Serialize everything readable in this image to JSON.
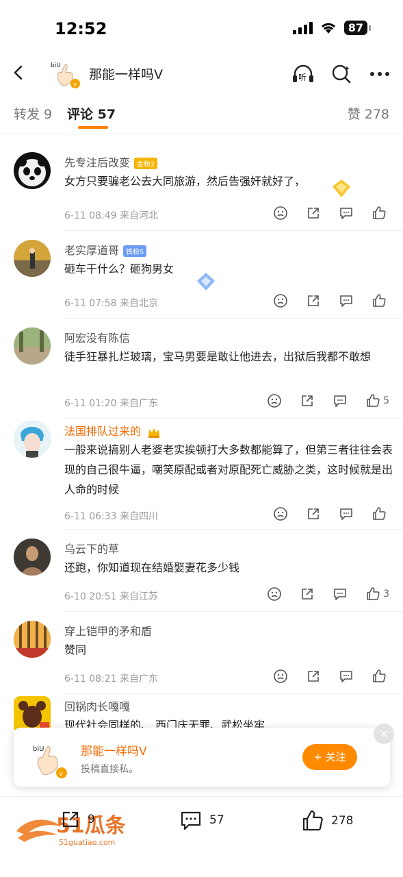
{
  "status": {
    "time": "12:52",
    "battery": "87"
  },
  "nav": {
    "title": "那能一样吗V",
    "listen_label": "听"
  },
  "tabs": {
    "repost": "转发 9",
    "comments": "评论 57",
    "likes": "赞 278"
  },
  "comments": [
    {
      "name": "先专注后改变",
      "badge": "金粉2",
      "badge_type": "gold",
      "text": "女方只要骗老公去大同旅游，然后告强奸就好了，",
      "meta": "6-11 08:49 来自河北",
      "likes": ""
    },
    {
      "name": "老实厚道哥",
      "badge": "铁粉5",
      "badge_type": "iron",
      "text": "砸车干什么？砸狗男女",
      "meta": "6-11 07:58 来自北京",
      "likes": ""
    },
    {
      "name": "阿宏没有陈信",
      "badge": "",
      "text": "徒手狂暴扎烂玻璃，宝马男要是敢让他进去，出狱后我都不敢想",
      "meta": "6-11 01:20 来自广东",
      "likes": "5"
    },
    {
      "name": "法国排队过来的",
      "badge": "",
      "vip": true,
      "text": "一般来说搞别人老婆老实挨顿打大多数都能算了，但第三者往往会表现的自己很牛逼，嘲笑原配或者对原配死亡威胁之类，这时候就是出人命的时候",
      "meta": "6-11 06:33 来自四川",
      "likes": ""
    },
    {
      "name": "乌云下的草",
      "badge": "",
      "text": "还跑，你知道现在结婚娶妻花多少钱",
      "meta": "6-10 20:51 来自江苏",
      "likes": "3"
    },
    {
      "name": "穿上铠甲的矛和盾",
      "badge": "",
      "text": "赞同",
      "meta": "6-11 08:21 来自广东",
      "likes": ""
    },
    {
      "name": "回锅肉长嘎嘎",
      "badge": "",
      "text": "现代社会同样的、 西门庆无罪、武松坐牢",
      "meta": "",
      "likes": ""
    }
  ],
  "popup": {
    "name": "那能一样吗V",
    "sub": "投稿直接私。",
    "follow": "+ 关注",
    "close": "×"
  },
  "bottom": {
    "repost": "9",
    "comments": "57",
    "likes": "278"
  },
  "watermark": {
    "text": "51瓜条",
    "url": "51guatiao.com"
  }
}
